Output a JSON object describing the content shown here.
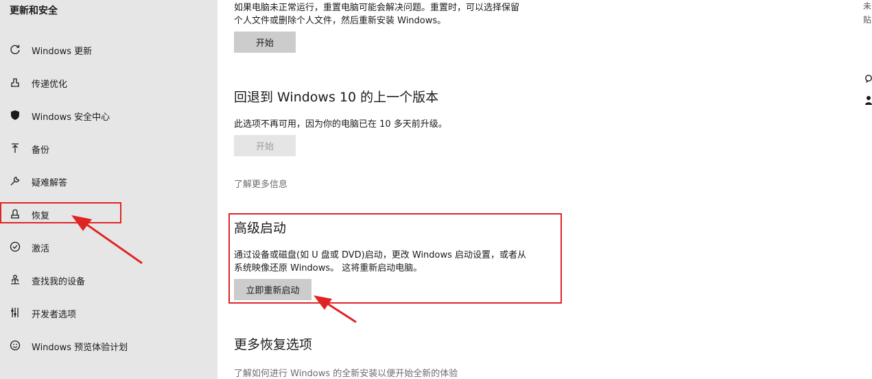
{
  "sidebar": {
    "title": "更新和安全",
    "items": [
      {
        "label": "Windows 更新",
        "icon": "sync-icon"
      },
      {
        "label": "传递优化",
        "icon": "delivery-optimization-icon"
      },
      {
        "label": "Windows 安全中心",
        "icon": "shield-icon"
      },
      {
        "label": "备份",
        "icon": "backup-arrow-icon"
      },
      {
        "label": "疑难解答",
        "icon": "wrench-icon"
      },
      {
        "label": "恢复",
        "icon": "recovery-icon",
        "active": true
      },
      {
        "label": "激活",
        "icon": "check-circle-icon"
      },
      {
        "label": "查找我的设备",
        "icon": "person-location-icon"
      },
      {
        "label": "开发者选项",
        "icon": "developer-sliders-icon"
      },
      {
        "label": "Windows 预览体验计划",
        "icon": "insider-smiley-icon"
      }
    ]
  },
  "reset": {
    "desc_line1": "如果电脑未正常运行，重置电脑可能会解决问题。重置时，可以选择保留",
    "desc_line2": "个人文件或删除个人文件，然后重新安装 Windows。",
    "button": "开始"
  },
  "rollback": {
    "heading": "回退到 Windows 10 的上一个版本",
    "desc": "此选项不再可用，因为你的电脑已在 10 多天前升级。",
    "button": "开始",
    "learn_more": "了解更多信息"
  },
  "advanced": {
    "heading": "高级启动",
    "desc_line1": "通过设备或磁盘(如 U 盘或 DVD)启动，更改 Windows 启动设置，或者从",
    "desc_line2": "系统映像还原 Windows。 这将重新启动电脑。",
    "button": "立即重新启动"
  },
  "more": {
    "heading": "更多恢复选项",
    "link": "了解如何进行 Windows 的全新安装以便开始全新的体验"
  },
  "right_edge": {
    "chars": [
      "未",
      "贴"
    ]
  },
  "colors": {
    "annotation_red": "#e02323",
    "sidebar_bg": "#e6e6e6",
    "button_bg": "#cccccc"
  }
}
